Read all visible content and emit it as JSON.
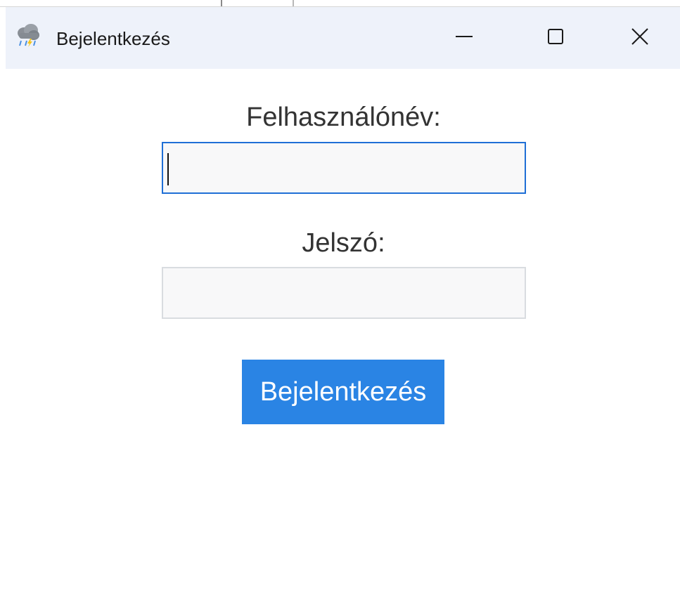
{
  "window": {
    "title": "Bejelentkezés",
    "icon": "storm-cloud-icon",
    "controls": {
      "minimize": "minimize-icon",
      "maximize": "maximize-icon",
      "close": "close-icon"
    }
  },
  "form": {
    "username_label": "Felhasználónév:",
    "username_value": "",
    "password_label": "Jelszó:",
    "password_value": "",
    "login_button": "Bejelentkezés"
  },
  "colors": {
    "titlebar": "#eef2fa",
    "focus_border": "#1f6fd6",
    "button": "#2a84e4",
    "button_text": "#ffffff"
  }
}
